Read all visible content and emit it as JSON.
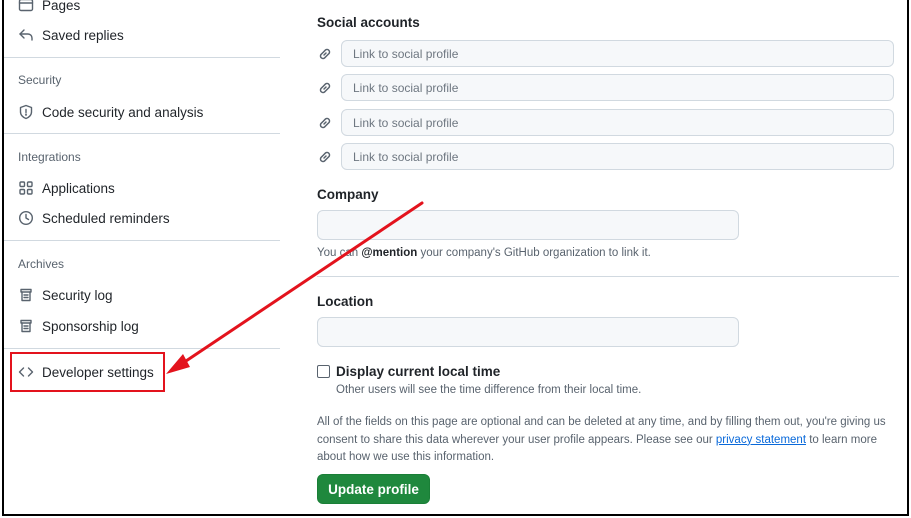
{
  "sidebar": {
    "pages_label": "Pages",
    "saved_replies_label": "Saved replies",
    "security_heading": "Security",
    "code_security_label": "Code security and analysis",
    "integrations_heading": "Integrations",
    "applications_label": "Applications",
    "scheduled_reminders_label": "Scheduled reminders",
    "archives_heading": "Archives",
    "security_log_label": "Security log",
    "sponsorship_log_label": "Sponsorship log",
    "developer_settings_label": "Developer settings"
  },
  "main": {
    "social_heading": "Social accounts",
    "social_placeholder": "Link to social profile",
    "company_heading": "Company",
    "company_note_prefix": "You can ",
    "company_note_mention": "@mention",
    "company_note_suffix": " your company's GitHub organization to link it.",
    "location_heading": "Location",
    "local_time_label": "Display current local time",
    "local_time_note": "Other users will see the time difference from their local time.",
    "privacy_pre": "All of the fields on this page are optional and can be deleted at any time, and by filling them out, you're giving us consent to share this data wherever your user profile appears. Please see our ",
    "privacy_link": "privacy statement",
    "privacy_post": " to learn more about how we use this information.",
    "update_button": "Update profile"
  },
  "annotation": {
    "color": "#e3131d"
  },
  "colors": {
    "primary_button": "#1f883d",
    "link": "#0969da"
  }
}
